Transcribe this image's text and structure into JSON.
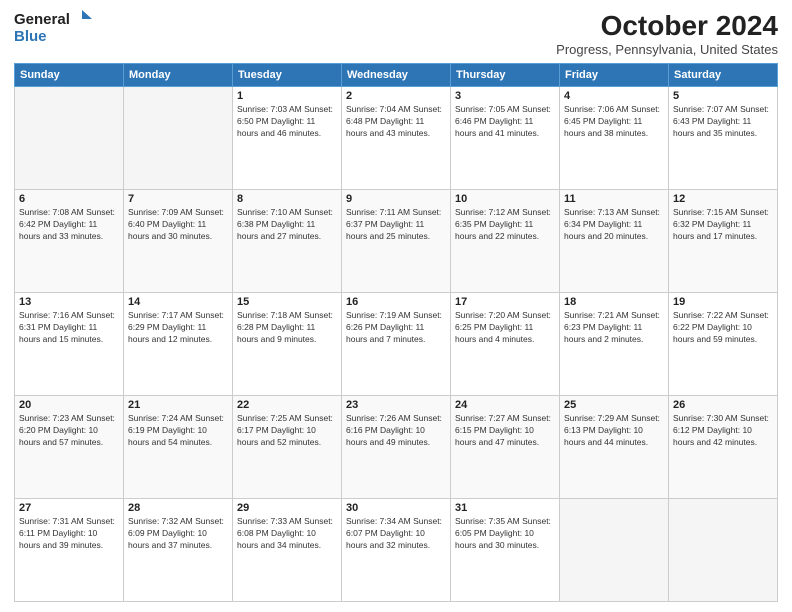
{
  "logo": {
    "line1": "General",
    "line2": "Blue"
  },
  "title": "October 2024",
  "subtitle": "Progress, Pennsylvania, United States",
  "days_of_week": [
    "Sunday",
    "Monday",
    "Tuesday",
    "Wednesday",
    "Thursday",
    "Friday",
    "Saturday"
  ],
  "weeks": [
    [
      {
        "day": "",
        "info": "",
        "empty": true
      },
      {
        "day": "",
        "info": "",
        "empty": true
      },
      {
        "day": "1",
        "info": "Sunrise: 7:03 AM\nSunset: 6:50 PM\nDaylight: 11 hours and 46 minutes.",
        "empty": false
      },
      {
        "day": "2",
        "info": "Sunrise: 7:04 AM\nSunset: 6:48 PM\nDaylight: 11 hours and 43 minutes.",
        "empty": false
      },
      {
        "day": "3",
        "info": "Sunrise: 7:05 AM\nSunset: 6:46 PM\nDaylight: 11 hours and 41 minutes.",
        "empty": false
      },
      {
        "day": "4",
        "info": "Sunrise: 7:06 AM\nSunset: 6:45 PM\nDaylight: 11 hours and 38 minutes.",
        "empty": false
      },
      {
        "day": "5",
        "info": "Sunrise: 7:07 AM\nSunset: 6:43 PM\nDaylight: 11 hours and 35 minutes.",
        "empty": false
      }
    ],
    [
      {
        "day": "6",
        "info": "Sunrise: 7:08 AM\nSunset: 6:42 PM\nDaylight: 11 hours and 33 minutes.",
        "empty": false
      },
      {
        "day": "7",
        "info": "Sunrise: 7:09 AM\nSunset: 6:40 PM\nDaylight: 11 hours and 30 minutes.",
        "empty": false
      },
      {
        "day": "8",
        "info": "Sunrise: 7:10 AM\nSunset: 6:38 PM\nDaylight: 11 hours and 27 minutes.",
        "empty": false
      },
      {
        "day": "9",
        "info": "Sunrise: 7:11 AM\nSunset: 6:37 PM\nDaylight: 11 hours and 25 minutes.",
        "empty": false
      },
      {
        "day": "10",
        "info": "Sunrise: 7:12 AM\nSunset: 6:35 PM\nDaylight: 11 hours and 22 minutes.",
        "empty": false
      },
      {
        "day": "11",
        "info": "Sunrise: 7:13 AM\nSunset: 6:34 PM\nDaylight: 11 hours and 20 minutes.",
        "empty": false
      },
      {
        "day": "12",
        "info": "Sunrise: 7:15 AM\nSunset: 6:32 PM\nDaylight: 11 hours and 17 minutes.",
        "empty": false
      }
    ],
    [
      {
        "day": "13",
        "info": "Sunrise: 7:16 AM\nSunset: 6:31 PM\nDaylight: 11 hours and 15 minutes.",
        "empty": false
      },
      {
        "day": "14",
        "info": "Sunrise: 7:17 AM\nSunset: 6:29 PM\nDaylight: 11 hours and 12 minutes.",
        "empty": false
      },
      {
        "day": "15",
        "info": "Sunrise: 7:18 AM\nSunset: 6:28 PM\nDaylight: 11 hours and 9 minutes.",
        "empty": false
      },
      {
        "day": "16",
        "info": "Sunrise: 7:19 AM\nSunset: 6:26 PM\nDaylight: 11 hours and 7 minutes.",
        "empty": false
      },
      {
        "day": "17",
        "info": "Sunrise: 7:20 AM\nSunset: 6:25 PM\nDaylight: 11 hours and 4 minutes.",
        "empty": false
      },
      {
        "day": "18",
        "info": "Sunrise: 7:21 AM\nSunset: 6:23 PM\nDaylight: 11 hours and 2 minutes.",
        "empty": false
      },
      {
        "day": "19",
        "info": "Sunrise: 7:22 AM\nSunset: 6:22 PM\nDaylight: 10 hours and 59 minutes.",
        "empty": false
      }
    ],
    [
      {
        "day": "20",
        "info": "Sunrise: 7:23 AM\nSunset: 6:20 PM\nDaylight: 10 hours and 57 minutes.",
        "empty": false
      },
      {
        "day": "21",
        "info": "Sunrise: 7:24 AM\nSunset: 6:19 PM\nDaylight: 10 hours and 54 minutes.",
        "empty": false
      },
      {
        "day": "22",
        "info": "Sunrise: 7:25 AM\nSunset: 6:17 PM\nDaylight: 10 hours and 52 minutes.",
        "empty": false
      },
      {
        "day": "23",
        "info": "Sunrise: 7:26 AM\nSunset: 6:16 PM\nDaylight: 10 hours and 49 minutes.",
        "empty": false
      },
      {
        "day": "24",
        "info": "Sunrise: 7:27 AM\nSunset: 6:15 PM\nDaylight: 10 hours and 47 minutes.",
        "empty": false
      },
      {
        "day": "25",
        "info": "Sunrise: 7:29 AM\nSunset: 6:13 PM\nDaylight: 10 hours and 44 minutes.",
        "empty": false
      },
      {
        "day": "26",
        "info": "Sunrise: 7:30 AM\nSunset: 6:12 PM\nDaylight: 10 hours and 42 minutes.",
        "empty": false
      }
    ],
    [
      {
        "day": "27",
        "info": "Sunrise: 7:31 AM\nSunset: 6:11 PM\nDaylight: 10 hours and 39 minutes.",
        "empty": false
      },
      {
        "day": "28",
        "info": "Sunrise: 7:32 AM\nSunset: 6:09 PM\nDaylight: 10 hours and 37 minutes.",
        "empty": false
      },
      {
        "day": "29",
        "info": "Sunrise: 7:33 AM\nSunset: 6:08 PM\nDaylight: 10 hours and 34 minutes.",
        "empty": false
      },
      {
        "day": "30",
        "info": "Sunrise: 7:34 AM\nSunset: 6:07 PM\nDaylight: 10 hours and 32 minutes.",
        "empty": false
      },
      {
        "day": "31",
        "info": "Sunrise: 7:35 AM\nSunset: 6:05 PM\nDaylight: 10 hours and 30 minutes.",
        "empty": false
      },
      {
        "day": "",
        "info": "",
        "empty": true
      },
      {
        "day": "",
        "info": "",
        "empty": true
      }
    ]
  ]
}
